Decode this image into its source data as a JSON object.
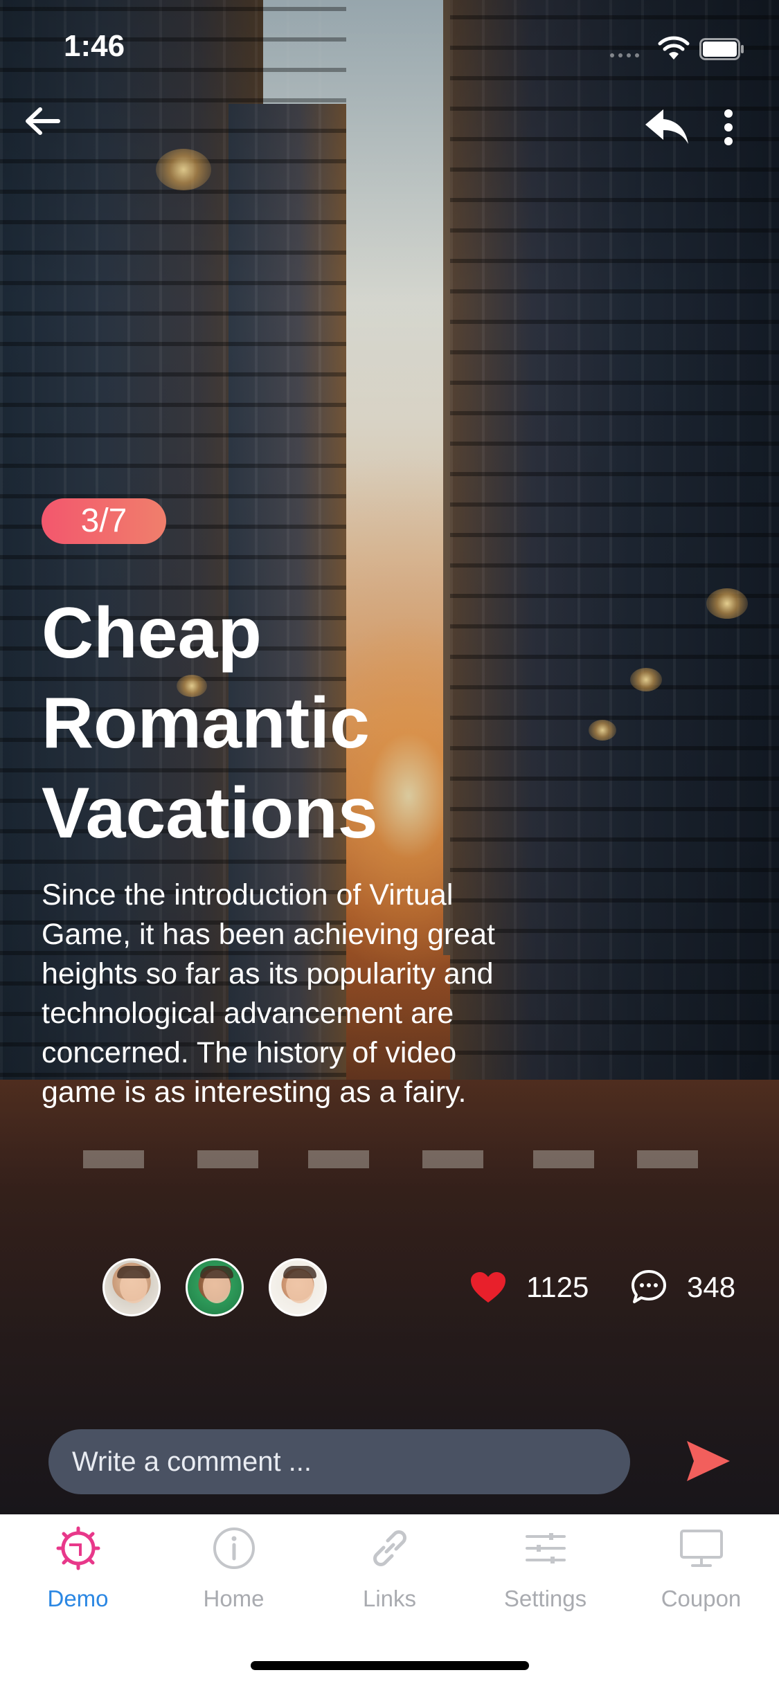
{
  "status_bar": {
    "time": "1:46"
  },
  "header": {
    "back_icon": "arrow-left-icon",
    "reply_icon": "reply-icon",
    "more_icon": "more-vertical-icon"
  },
  "article": {
    "page_indicator": "3/7",
    "title_lines": [
      "Cheap",
      "Romantic",
      "Vacations"
    ],
    "body_lines": [
      "Since the introduction of Virtual",
      "Game, it has been achieving great",
      "heights so far as its popularity and",
      "technological advancement are",
      "concerned. The history of video",
      "game is as interesting as a fairy."
    ]
  },
  "social": {
    "likes": "1125",
    "comments": "348",
    "like_color": "#e8202b"
  },
  "comment_box": {
    "placeholder": "Write a comment ...",
    "send_icon": "send-icon",
    "send_color": "#f25f5c"
  },
  "tabs": [
    {
      "label": "Demo",
      "icon": "demo-gear-icon",
      "active": true
    },
    {
      "label": "Home",
      "icon": "info-icon",
      "active": false
    },
    {
      "label": "Links",
      "icon": "link-icon",
      "active": false
    },
    {
      "label": "Settings",
      "icon": "sliders-icon",
      "active": false
    },
    {
      "label": "Coupon",
      "icon": "monitor-icon",
      "active": false
    }
  ],
  "colors": {
    "badge_gradient_start": "#f3576d",
    "badge_gradient_end": "#f07f6c",
    "active_tab": "#2b87e3",
    "active_tab_icon": "#e8388a",
    "inactive_tab": "#a9abb0"
  }
}
